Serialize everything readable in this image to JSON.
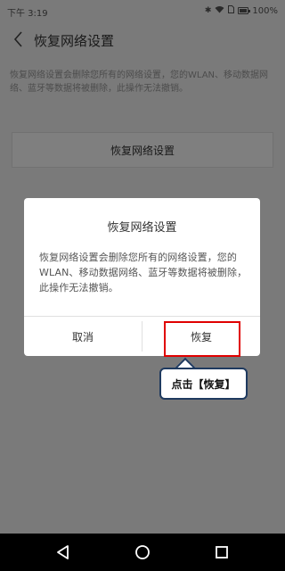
{
  "status_bar": {
    "time": "下午 3:19",
    "battery": "100%"
  },
  "header": {
    "title": "恢复网络设置"
  },
  "page": {
    "description": "恢复网络设置会删除您所有的网络设置，您的WLAN、移动数据网络、蓝牙等数据将被删除，此操作无法撤销。",
    "reset_button": "恢复网络设置"
  },
  "dialog": {
    "title": "恢复网络设置",
    "message": "恢复网络设置会删除您所有的网络设置，您的WLAN、移动数据网络、蓝牙等数据将被删除，此操作无法撤销。",
    "cancel_label": "取消",
    "confirm_label": "恢复"
  },
  "annotation": {
    "tooltip": "点击【恢复】",
    "highlight_color": "#e00000",
    "tooltip_border_color": "#1f3a5f"
  },
  "icons": [
    "back-icon",
    "bluetooth-icon",
    "wifi-icon",
    "sim-icon",
    "battery-icon",
    "nav-back-icon",
    "nav-home-icon",
    "nav-recent-icon"
  ]
}
